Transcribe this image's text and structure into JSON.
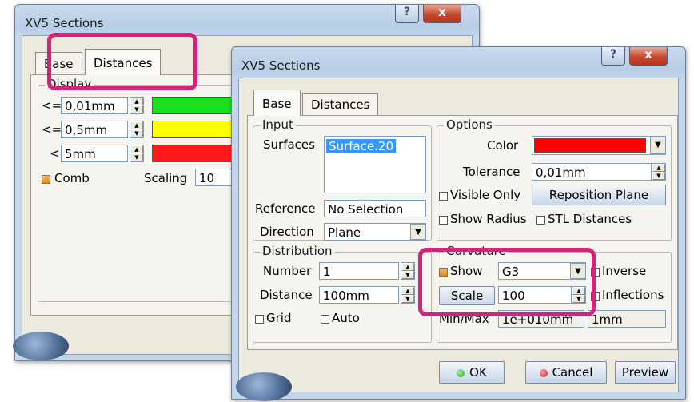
{
  "back_window": {
    "title": "XV5 Sections",
    "help_symbol": "?",
    "close_symbol": "x",
    "tabs": [
      {
        "label": "Base"
      },
      {
        "label": "Distances"
      }
    ],
    "display_group": {
      "legend": "Display",
      "rows": [
        {
          "operator": "<=",
          "value": "0,01mm",
          "color": "#1ddf22"
        },
        {
          "operator": "<=",
          "value": "0,5mm",
          "color": "#ffff00"
        },
        {
          "operator": "<",
          "value": "5mm",
          "color": "#ff1a1a"
        }
      ],
      "comb_label": "Comb",
      "scaling_label": "Scaling",
      "scaling_value": "10"
    }
  },
  "front_window": {
    "title": "XV5 Sections",
    "help_symbol": "?",
    "close_symbol": "x",
    "tabs": [
      {
        "label": "Base"
      },
      {
        "label": "Distances"
      }
    ],
    "input_group": {
      "legend": "Input",
      "surfaces_label": "Surfaces",
      "surfaces_value": "Surface.20",
      "reference_label": "Reference",
      "reference_value": "No Selection",
      "direction_label": "Direction",
      "direction_value": "Plane"
    },
    "options_group": {
      "legend": "Options",
      "color_label": "Color",
      "color_value": "#ff0000",
      "tolerance_label": "Tolerance",
      "tolerance_value": "0,01mm",
      "visible_only_label": "Visible Only",
      "reposition_plane_label": "Reposition Plane",
      "show_radius_label": "Show Radius",
      "stl_distances_label": "STL Distances"
    },
    "distribution_group": {
      "legend": "Distribution",
      "number_label": "Number",
      "number_value": "1",
      "distance_label": "Distance",
      "distance_value": "100mm",
      "grid_label": "Grid",
      "auto_label": "Auto"
    },
    "curvature_group": {
      "legend": "Curvature",
      "show_label": "Show",
      "show_value": "G3",
      "inverse_label": "Inverse",
      "scale_label": "Scale",
      "scale_value": "100",
      "inflections_label": "Inflections",
      "minmax_label": "Min/Max",
      "min_value": "1e+010mm",
      "max_value": "1mm"
    },
    "buttons": {
      "ok_label": "OK",
      "cancel_label": "Cancel",
      "preview_label": "Preview"
    }
  },
  "colors": {
    "highlight": "#d3237a",
    "ok_dot": "#22b21f",
    "cancel_dot": "#e02020"
  }
}
